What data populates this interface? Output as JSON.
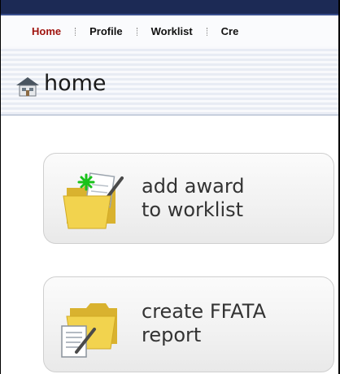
{
  "nav": {
    "items": [
      {
        "label": "Home",
        "active": true
      },
      {
        "label": "Profile",
        "active": false
      },
      {
        "label": "Worklist",
        "active": false
      },
      {
        "label": "Cre",
        "active": false
      }
    ]
  },
  "page": {
    "title": "home",
    "icon": "home-icon"
  },
  "actions": [
    {
      "line1": "add award",
      "line2": "to worklist",
      "icon": "folder-add-icon"
    },
    {
      "line1": "create FFATA",
      "line2": "report",
      "icon": "folder-report-icon"
    }
  ],
  "colors": {
    "topbar": "#1c2a55",
    "active_nav": "#a0140f",
    "folder": "#f2d34e"
  }
}
